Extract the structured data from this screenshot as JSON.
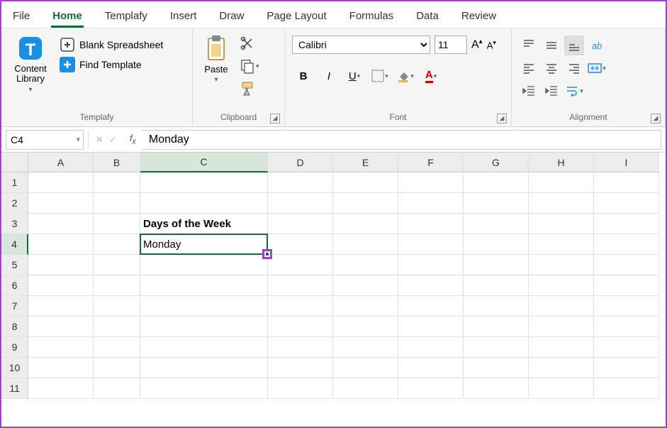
{
  "tabs": [
    "File",
    "Home",
    "Templafy",
    "Insert",
    "Draw",
    "Page Layout",
    "Formulas",
    "Data",
    "Review"
  ],
  "active_tab": "Home",
  "groups": {
    "templafy": {
      "label": "Templafy",
      "content_library": "Content Library",
      "blank": "Blank Spreadsheet",
      "find": "Find Template"
    },
    "clipboard": {
      "label": "Clipboard",
      "paste": "Paste"
    },
    "font": {
      "label": "Font",
      "name": "Calibri",
      "size": "11"
    },
    "alignment": {
      "label": "Alignment"
    }
  },
  "name_box": "C4",
  "formula_value": "Monday",
  "columns": [
    {
      "l": "A",
      "w": 92
    },
    {
      "l": "B",
      "w": 66
    },
    {
      "l": "C",
      "w": 180
    },
    {
      "l": "D",
      "w": 92
    },
    {
      "l": "E",
      "w": 92
    },
    {
      "l": "F",
      "w": 92
    },
    {
      "l": "G",
      "w": 92
    },
    {
      "l": "H",
      "w": 92
    },
    {
      "l": "I",
      "w": 92
    }
  ],
  "rows": [
    1,
    2,
    3,
    4,
    5,
    6,
    7,
    8,
    9,
    10,
    11
  ],
  "selected": {
    "col": "C",
    "row": 4
  },
  "cells": {
    "C3": {
      "v": "Days of the Week",
      "bold": true
    },
    "C4": {
      "v": "Monday"
    }
  }
}
